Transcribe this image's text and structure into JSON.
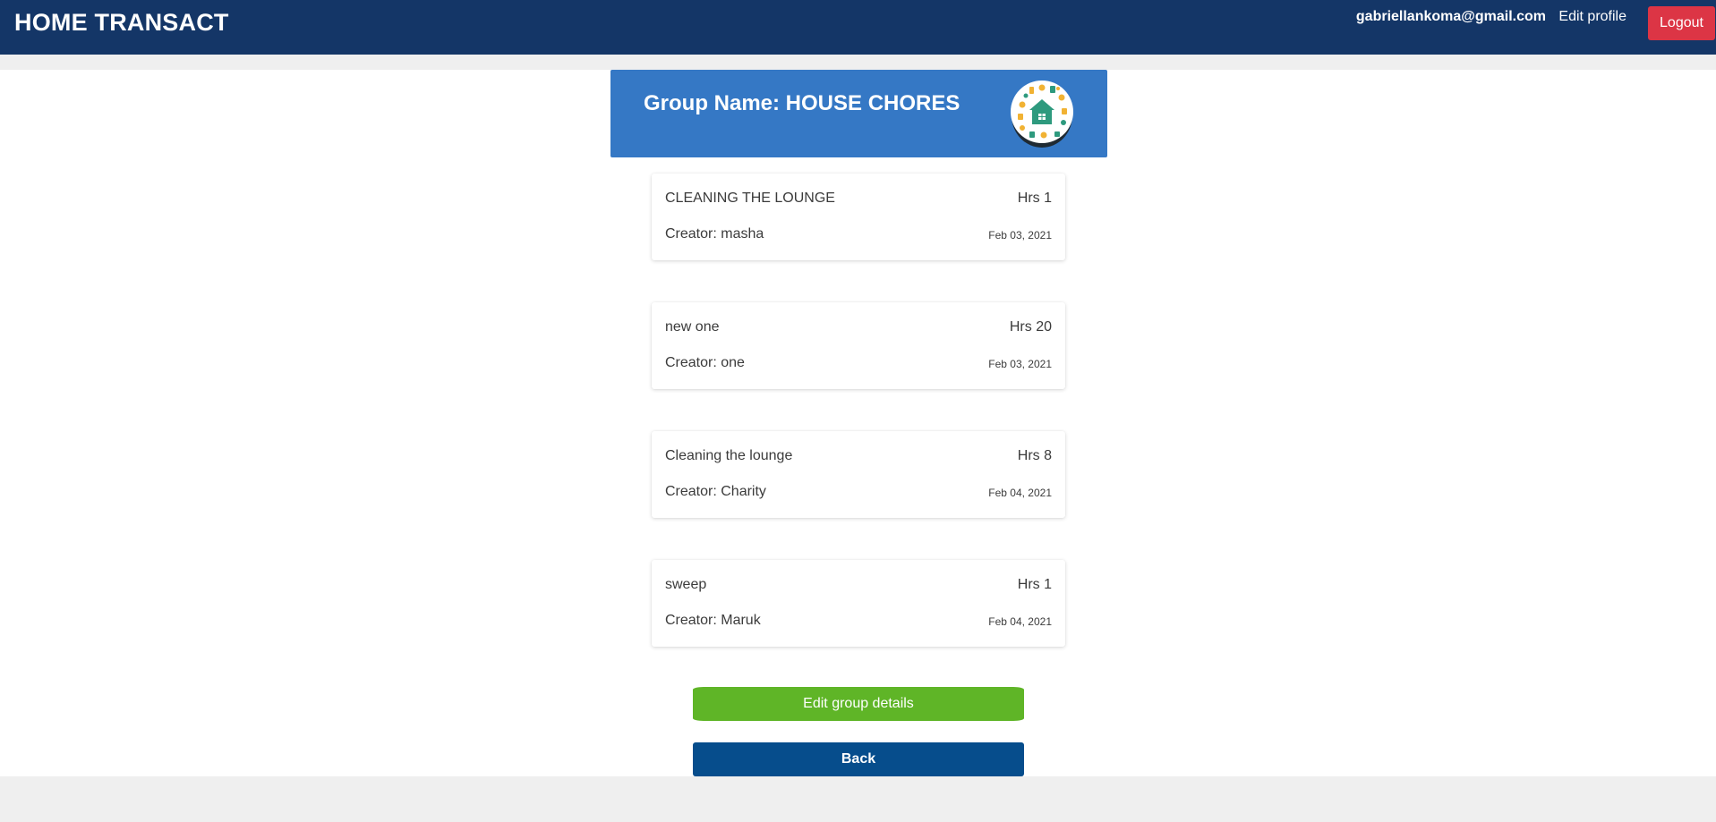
{
  "navbar": {
    "brand": "HOME TRANSACT",
    "user_email": "gabriellankoma@gmail.com",
    "edit_profile_label": "Edit profile",
    "logout_label": "Logout"
  },
  "group": {
    "title": "Group Name: HOUSE CHORES",
    "avatar_icon": "house-chores-icon"
  },
  "tasks": [
    {
      "title": "CLEANING THE LOUNGE",
      "hours": "Hrs 1",
      "creator": "Creator: masha",
      "date": "Feb 03, 2021"
    },
    {
      "title": "new one",
      "hours": "Hrs 20",
      "creator": "Creator: one",
      "date": "Feb 03, 2021"
    },
    {
      "title": "Cleaning the lounge",
      "hours": "Hrs 8",
      "creator": "Creator: Charity",
      "date": "Feb 04, 2021"
    },
    {
      "title": "sweep",
      "hours": "Hrs 1",
      "creator": "Creator: Maruk",
      "date": "Feb 04, 2021"
    }
  ],
  "actions": {
    "edit_group_label": "Edit group details",
    "back_label": "Back"
  },
  "colors": {
    "navbar": "#143667",
    "group_header": "#3578c5",
    "logout": "#dc3545",
    "edit_group": "#5fb527",
    "back": "#064d8c"
  }
}
